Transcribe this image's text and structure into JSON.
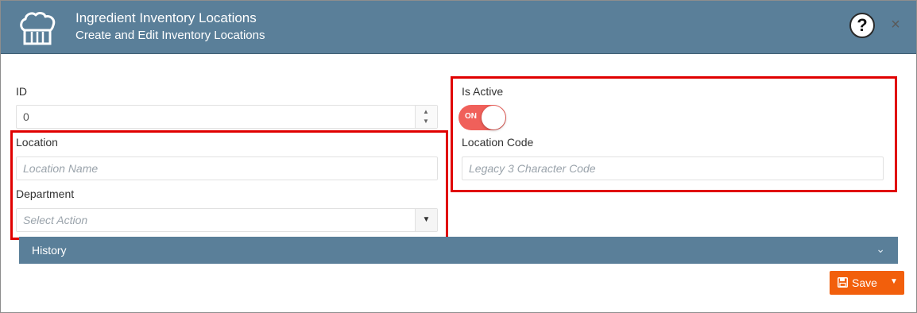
{
  "header": {
    "title": "Ingredient Inventory Locations",
    "subtitle": "Create and Edit Inventory Locations",
    "logo_icon": "chef-hat-icon",
    "help_label": "?",
    "close_label": "×"
  },
  "form": {
    "id": {
      "label": "ID",
      "value": "0"
    },
    "location": {
      "label": "Location",
      "placeholder": "Location Name"
    },
    "department": {
      "label": "Department",
      "placeholder": "Select Action"
    },
    "is_active": {
      "label": "Is Active",
      "toggle_text": "ON",
      "value": true
    },
    "location_code": {
      "label": "Location Code",
      "placeholder": "Legacy 3 Character Code"
    }
  },
  "history": {
    "label": "History"
  },
  "footer": {
    "save_label": "Save"
  },
  "colors": {
    "header_bg": "#5a7f99",
    "accent_orange": "#f25f0c",
    "toggle_on": "#f0605a",
    "highlight": "#e00000"
  }
}
